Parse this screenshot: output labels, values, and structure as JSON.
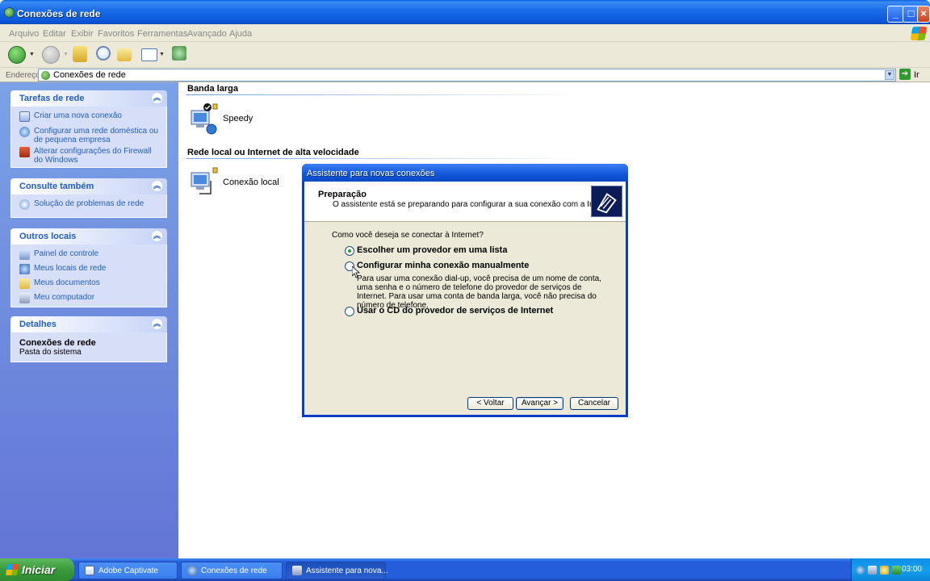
{
  "window": {
    "title": "Conexões de rede",
    "menu": [
      "Arquivo",
      "Editar",
      "Exibir",
      "Favoritos",
      "Ferramentas",
      "Avançado",
      "Ajuda"
    ],
    "toolbar_icons": [
      "back-icon",
      "forward-icon",
      "up-folder-icon",
      "search-icon",
      "folders-icon",
      "views-icon",
      "sync-icon"
    ],
    "address": {
      "label": "Endereço",
      "value": "Conexões de rede",
      "go_label": "Ir"
    }
  },
  "taskpane": {
    "network_tasks": {
      "title": "Tarefas de rede",
      "items": [
        "Criar uma nova conexão",
        "Configurar uma rede doméstica ou de pequena empresa",
        "Alterar configurações do Firewall do Windows"
      ]
    },
    "see_also": {
      "title": "Consulte também",
      "items": [
        "Solução de problemas de rede"
      ]
    },
    "other_places": {
      "title": "Outros locais",
      "items": [
        "Painel de controle",
        "Meus locais de rede",
        "Meus documentos",
        "Meu computador"
      ]
    },
    "details": {
      "title": "Detalhes",
      "name": "Conexões de rede",
      "type": "Pasta do sistema"
    }
  },
  "content": {
    "broadband": {
      "title": "Banda larga",
      "connection": "Speedy"
    },
    "lan": {
      "title": "Rede local ou Internet de alta velocidade",
      "connection": "Conexão local"
    }
  },
  "wizard": {
    "title": "Assistente para novas conexões",
    "header_title": "Preparação",
    "header_subtitle": "O assistente está se preparando para configurar a sua conexão com a Internet.",
    "question": "Como você deseja se conectar à Internet?",
    "options": [
      {
        "label": "Escolher um provedor em uma lista",
        "selected": true
      },
      {
        "label": "Configurar minha conexão manualmente",
        "selected": false
      },
      {
        "label": "Usar o CD do provedor de serviços de Internet",
        "selected": false
      }
    ],
    "manual_description": "Para usar uma conexão dial-up, você precisa de um nome de conta, uma senha e o número de telefone do provedor de serviços de Internet. Para usar uma conta de banda larga, você não precisa do número de telefone.",
    "buttons": {
      "back": "< Voltar",
      "next": "Avançar >",
      "cancel": "Cancelar"
    }
  },
  "taskbar": {
    "start_label": "Iniciar",
    "tasks": [
      "Adobe Captivate",
      "Conexões de rede",
      "Assistente para nova..."
    ],
    "clock": "03:00"
  }
}
